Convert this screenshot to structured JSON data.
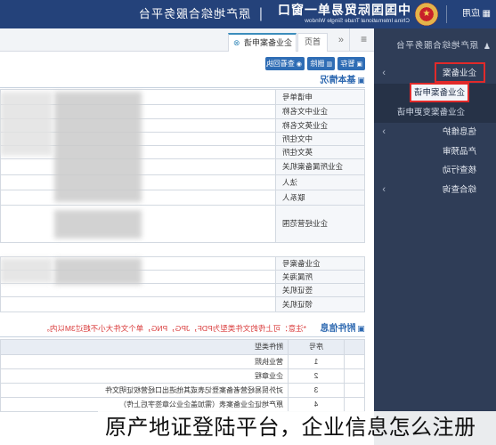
{
  "header": {
    "apps_label": "应用",
    "apps_icon": "grid-icon",
    "brand_cn": "中国国际贸易单一窗口",
    "brand_en": "China International Trade Single Window",
    "separator": "|",
    "platform_name": "原产地综合服务平台"
  },
  "sidebar": {
    "title": "原产地综合服务平台",
    "title_icon": "user-icon",
    "menu": [
      {
        "label": "企业备案",
        "expandable": true,
        "highlighted": true,
        "submenu": [
          {
            "label": "企业备案申请",
            "active": true,
            "highlighted": true
          },
          {
            "label": "企业备案变更申请"
          }
        ]
      },
      {
        "label": "信息维护",
        "expandable": true
      },
      {
        "label": "产品预审"
      },
      {
        "label": "核查行动"
      },
      {
        "label": "综合查询",
        "expandable": true
      }
    ]
  },
  "tabbar": {
    "menu_icon": "hamburger-icon",
    "scroll_icon": "double-chevron-icon",
    "tabs": [
      {
        "label": "首页"
      },
      {
        "label": "企业备案申请",
        "active": true,
        "close_icon": "close-circle-icon"
      }
    ]
  },
  "toolbar": {
    "buttons": [
      {
        "label": "暂存",
        "icon": "save-icon"
      },
      {
        "label": "删除",
        "icon": "trash-icon"
      },
      {
        "label": "查看回执",
        "icon": "eye-icon"
      }
    ]
  },
  "basic_info": {
    "title": "基本情况",
    "fields": [
      {
        "label": "申请单号"
      },
      {
        "label": "企业中文名称"
      },
      {
        "label": "企业英文名称"
      },
      {
        "label": "中文住所"
      },
      {
        "label": "英文住所"
      },
      {
        "label": "企业所属备案机关"
      },
      {
        "label": "法人"
      },
      {
        "label": "联系人"
      },
      {
        "label": "企业经营范围"
      }
    ]
  },
  "filing_info": {
    "fields": [
      {
        "label": "企业备案号"
      },
      {
        "label": "所属海关"
      },
      {
        "label": "签证机关"
      },
      {
        "label": "领证机关"
      }
    ]
  },
  "attachments": {
    "title": "附件信息",
    "note": "*注意：可上传的文件类型为PDF，JPG，PNG，单个文件大小不超过3M以内。",
    "columns": [
      "序号",
      "附件类型"
    ],
    "rows": [
      {
        "no": "1",
        "type": "营业执照"
      },
      {
        "no": "2",
        "type": "企业章程"
      },
      {
        "no": "3",
        "type": "对外贸易经营者备案登记表或其他进出口经营权证明文件"
      },
      {
        "no": "4",
        "type": "原产地证企业备案表（需加盖企业公章签字后上传）"
      }
    ]
  },
  "caption": "原产地证登陆平台，企业信息怎么注册",
  "colors": {
    "header_bg": "#24427a",
    "sidebar_bg": "#2f3d57",
    "accent": "#3c8dbc",
    "button_bg": "#2f6db5",
    "highlight_box": "#e12a2a",
    "note_text": "#d93a3a"
  }
}
